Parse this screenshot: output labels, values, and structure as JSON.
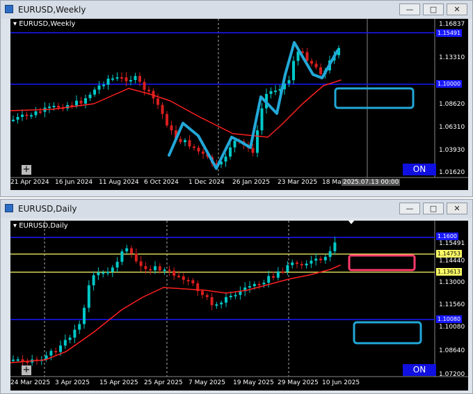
{
  "top": {
    "window_title": "EURUSD,Weekly",
    "chart_label": "EURUSD,Weekly",
    "buttons": {
      "min": "—",
      "max": "□",
      "close": "✕"
    },
    "prices": [
      "1.16837",
      "1.13310",
      "1.08620",
      "1.06310",
      "1.03930",
      "1.01620"
    ],
    "price_tags": [
      "1.15491",
      "1.10000"
    ],
    "dates": [
      "21 Apr 2024",
      "16 Jun 2024",
      "11 Aug 2024",
      "6 Oct 2024",
      "1 Dec 2024",
      "26 Jan 2025",
      "23 Mar 2025",
      "18 Ma"
    ],
    "cursor_date": "2025.07.13 00:00",
    "on_label": "ON",
    "plus_label": "+",
    "colors": {
      "bull": "#00c8c8",
      "bear": "#d81e1e",
      "ma": "#ff2020",
      "hline": "#1818ff",
      "highlight": "#22a8d8"
    }
  },
  "bottom": {
    "window_title": "EURUSD,Daily",
    "chart_label": "EURUSD,Daily",
    "buttons": {
      "min": "—",
      "max": "□",
      "close": "✕"
    },
    "prices": [
      "1.15491",
      "1.14753",
      "1.14440",
      "1.13613",
      "1.13000",
      "1.11560",
      "1.10080",
      "1.08640",
      "1.07200"
    ],
    "price_tags": [
      "1.1600",
      "1.10080"
    ],
    "dates": [
      "24 Mar 2025",
      "3 Apr 2025",
      "15 Apr 2025",
      "25 Apr 2025",
      "7 May 2025",
      "19 May 2025",
      "29 May 2025",
      "10 Jun 2025"
    ],
    "on_label": "ON",
    "plus_label": "+",
    "colors": {
      "bull": "#00c8c8",
      "bear": "#d81e1e",
      "ma": "#ff2020",
      "hline": "#1818ff",
      "yline": "#ffff66",
      "highlight": "#22a8d8",
      "pink": "#ff3b6b"
    }
  }
}
